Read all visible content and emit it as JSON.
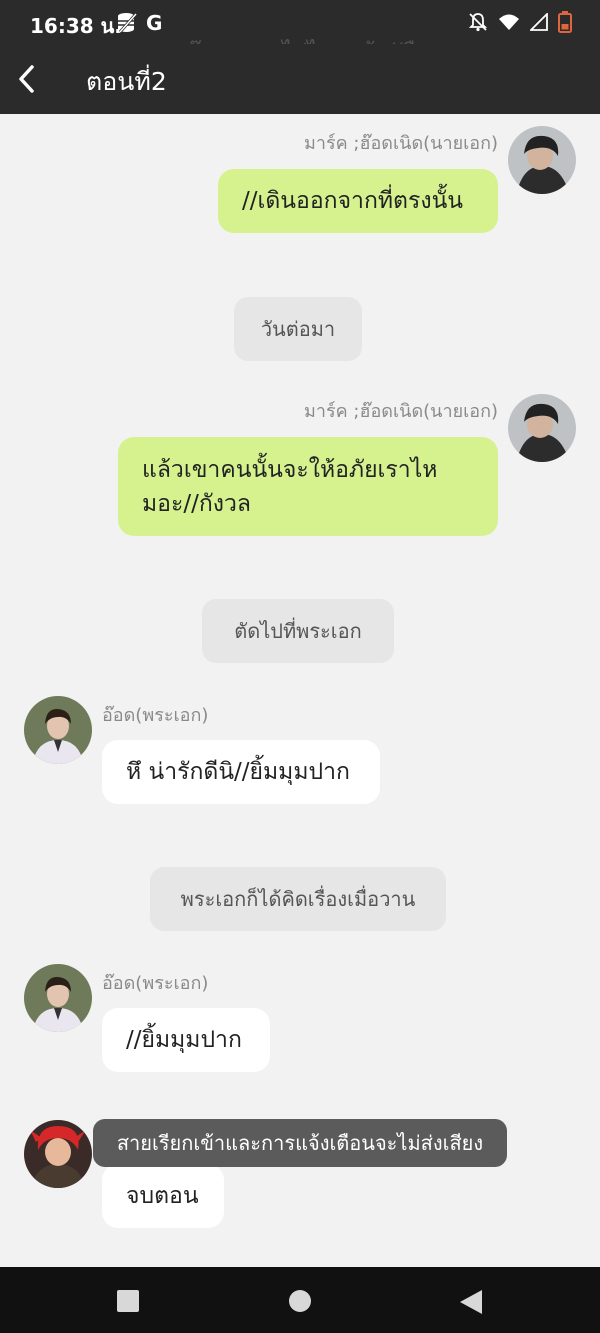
{
  "status": {
    "time": "16:38 น.",
    "g_label": "G"
  },
  "ghost_text": "อ๊าว~หายไปไหนแล้ว//ยืนงง",
  "header": {
    "title": "ตอนที่2"
  },
  "messages": {
    "m1": {
      "sender": "มาร์ค ;ฮ๊อดเนิด(นายเอก)",
      "text": "//เดินออกจากที่ตรงนั้น"
    },
    "n1": {
      "text": "วันต่อมา"
    },
    "m2": {
      "sender": "มาร์ค ;ฮ๊อดเนิด(นายเอก)",
      "text": "แล้วเขาคนนั้นจะให้อภัยเราไหมอะ//กังวล"
    },
    "n2": {
      "text": "ตัดไปที่พระเอก"
    },
    "m3": {
      "sender": "อ๊อด(พระเอก)",
      "text": "หึ น่ารักดีนิ//ยิ้มมุมปาก"
    },
    "n3": {
      "text": "พระเอกก็ได้คิดเรื่องเมื่อวาน"
    },
    "m4": {
      "sender": "อ๊อด(พระเอก)",
      "text": "//ยิ้มมุมปาก"
    },
    "m5": {
      "text": "จบตอน"
    }
  },
  "toast": {
    "text": "สายเรียกเข้าและการแจ้งเตือนจะไม่ส่งเสียง"
  },
  "colors": {
    "bar": "#2b2b2b",
    "bubble_right": "#d5f28f",
    "bubble_left": "#ffffff",
    "background": "#f2f2f2"
  },
  "icons": [
    "storage-icon",
    "bell-off-icon",
    "wifi-icon",
    "signal-icon",
    "battery-icon",
    "back-arrow-icon",
    "nav-recents-icon",
    "nav-home-icon",
    "nav-back-icon"
  ]
}
